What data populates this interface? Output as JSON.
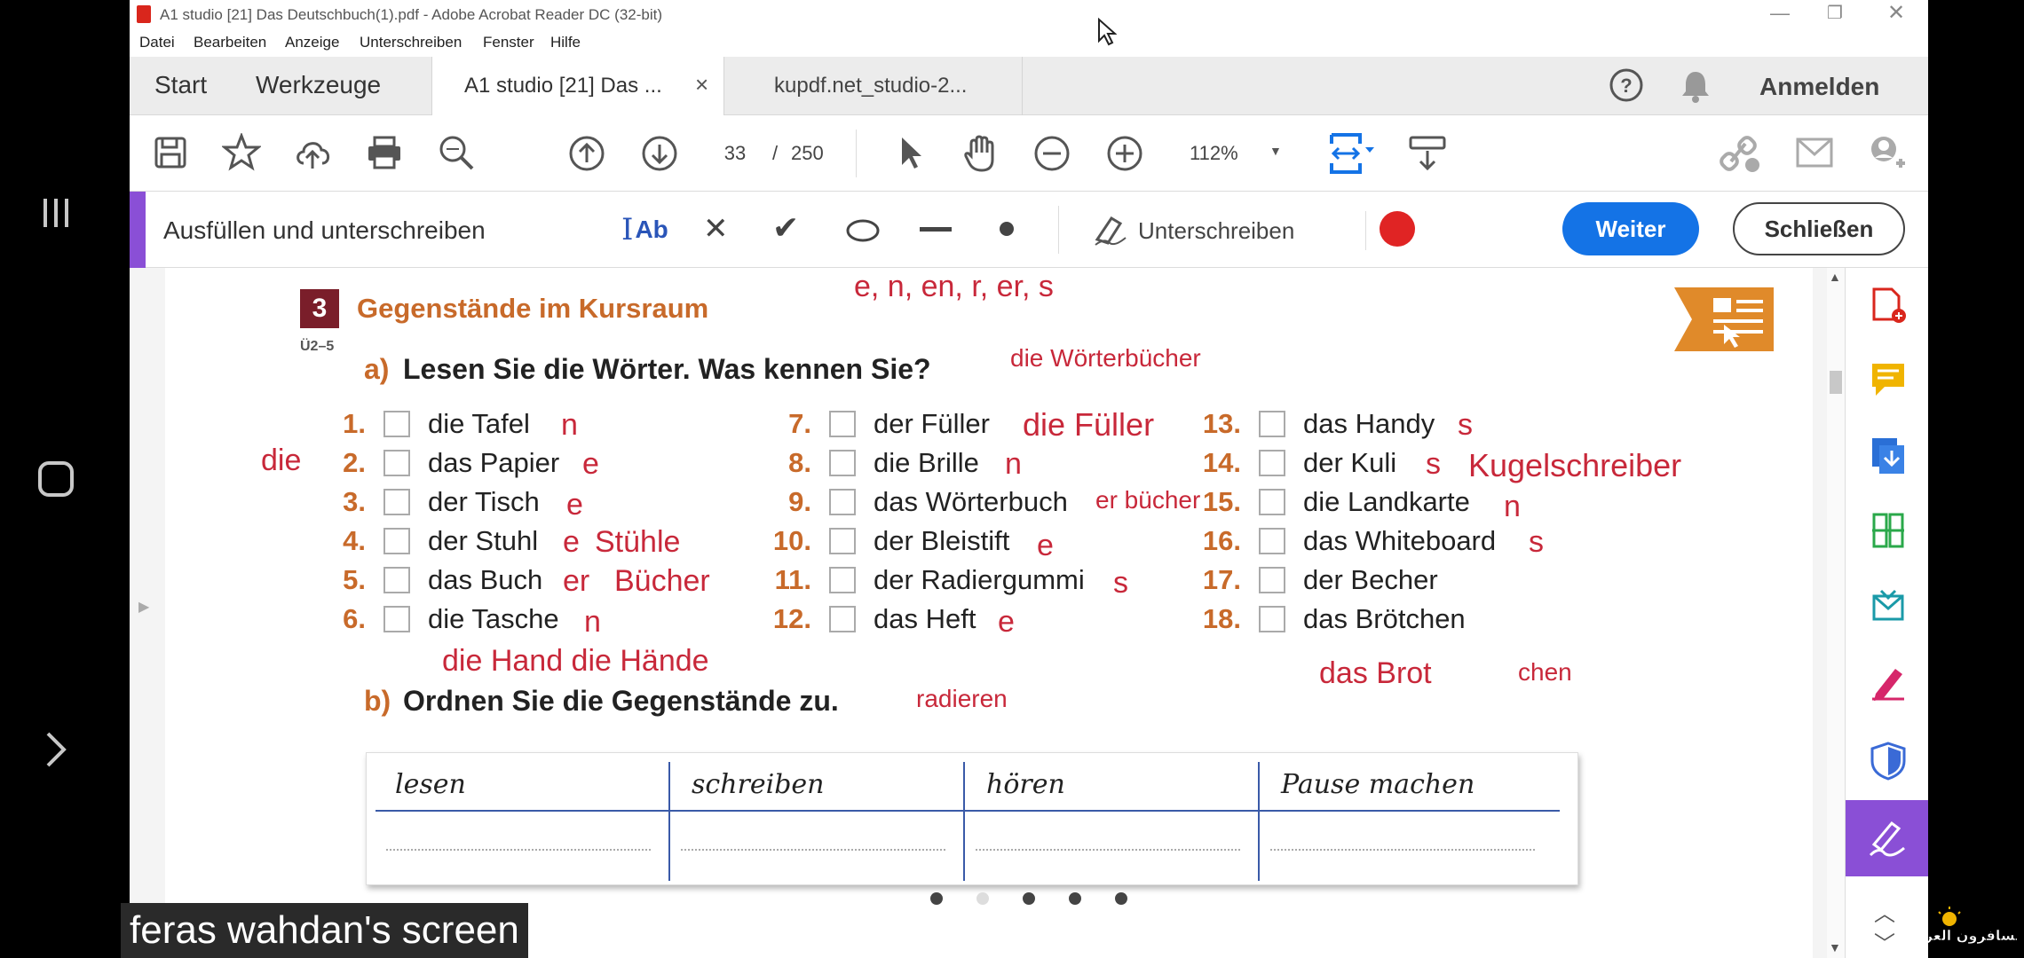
{
  "window": {
    "title": "A1 studio [21] Das Deutschbuch(1).pdf - Adobe Acrobat Reader DC (32-bit)"
  },
  "menu": [
    "Datei",
    "Bearbeiten",
    "Anzeige",
    "Unterschreiben",
    "Fenster",
    "Hilfe"
  ],
  "tabs": {
    "start": "Start",
    "tools": "Werkzeuge",
    "doc1": "A1 studio [21] Das ...",
    "doc2": "kupdf.net_studio-2...",
    "signin": "Anmelden"
  },
  "toolbar": {
    "page_current": "33",
    "page_sep": "/",
    "page_total": "250",
    "zoom": "112%"
  },
  "fillsign": {
    "title": "Ausfüllen und unterschreiben",
    "text_tool": "Ab",
    "sign_label": "Unterschreiben",
    "next_button": "Weiter",
    "close_button": "Schließen"
  },
  "exercise": {
    "number": "3",
    "title": "Gegenstände im Kursraum",
    "ref": "Ü2–5",
    "a_label": "a)",
    "a_text": "Lesen Sie die Wörter. Was kennen Sie?",
    "b_label": "b)",
    "b_text": "Ordnen Sie die Gegenstände zu.",
    "col1": [
      {
        "n": "1.",
        "w": "die Tafel"
      },
      {
        "n": "2.",
        "w": "das Papier"
      },
      {
        "n": "3.",
        "w": "der Tisch"
      },
      {
        "n": "4.",
        "w": "der Stuhl"
      },
      {
        "n": "5.",
        "w": "das Buch"
      },
      {
        "n": "6.",
        "w": "die Tasche"
      }
    ],
    "col2": [
      {
        "n": "7.",
        "w": "der Füller"
      },
      {
        "n": "8.",
        "w": "die Brille"
      },
      {
        "n": "9.",
        "w": "das Wörterbuch"
      },
      {
        "n": "10.",
        "w": "der Bleistift"
      },
      {
        "n": "11.",
        "w": "der Radiergummi"
      },
      {
        "n": "12.",
        "w": "das Heft"
      }
    ],
    "col3": [
      {
        "n": "13.",
        "w": "das Handy"
      },
      {
        "n": "14.",
        "w": "der Kuli"
      },
      {
        "n": "15.",
        "w": "die Landkarte"
      },
      {
        "n": "16.",
        "w": "das Whiteboard"
      },
      {
        "n": "17.",
        "w": "der Becher"
      },
      {
        "n": "18.",
        "w": "das Brötchen"
      }
    ],
    "table_headers": [
      "lesen",
      "schreiben",
      "hören",
      "Pause machen"
    ]
  },
  "annotations": {
    "endings": "e, n, en, r, er, s",
    "woerterbuecher": "die Wörterbücher",
    "die": "die",
    "a1": "n",
    "a2": "e",
    "a3": "e",
    "a4": "e",
    "a4b": "Stühle",
    "a5": "er",
    "a5b": "Bücher",
    "a6": "n",
    "a7": "die Füller",
    "a8": "n",
    "a9": "er bücher",
    "a10": "e",
    "a11": "s",
    "a12": "e",
    "a13": "s",
    "a14": "s",
    "a14b": "Kugelschreiber",
    "a15": "n",
    "a16": "s",
    "hand": "die Hand die Hände",
    "radieren": "radieren",
    "brot": "das Brot",
    "chen": "chen"
  },
  "overlay": {
    "screen_label": "feras wahdan's screen",
    "watermark": "المسافرون العرب"
  },
  "colors": {
    "accent_blue": "#1473e6",
    "annotation_red": "#c8283a",
    "fillsign_purple": "#8a4fd6",
    "record_red": "#e02424"
  }
}
